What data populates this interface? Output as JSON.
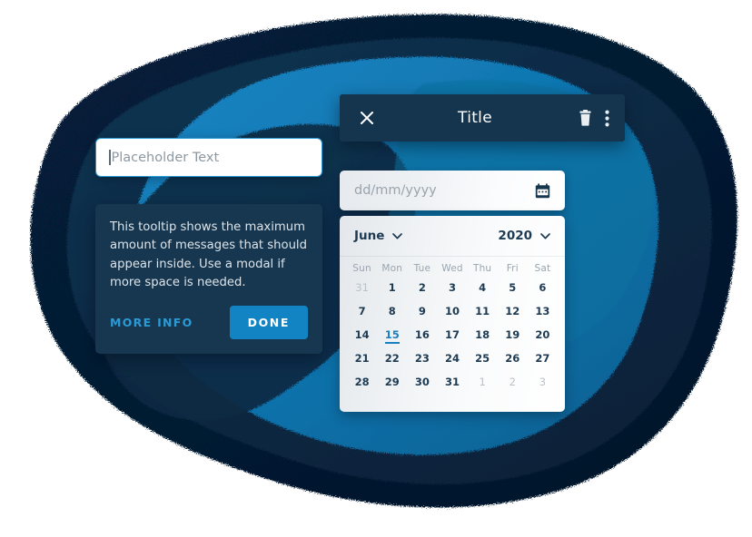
{
  "colors": {
    "blob_outer": "#061d34",
    "blob_mid": "#0b2b45",
    "blob_inner": "#0d72ab",
    "blob_inner2": "#1178b2",
    "accent_blue": "#1283c3",
    "link_blue": "#2b9ad6",
    "dark_navy": "#15354f",
    "tooltip_bg": "#16374f",
    "selected_day": "#1a7fc1",
    "muted_text": "#b9c2ca"
  },
  "modal": {
    "title": "Title",
    "close_icon": "close-x-icon",
    "delete_icon": "trash-icon",
    "overflow_icon": "more-vertical-icon"
  },
  "date_input": {
    "placeholder": "dd/mm/yyyy",
    "value": "",
    "icon": "calendar-icon"
  },
  "calendar": {
    "month": "June",
    "year": "2020",
    "month_chevron": "chevron-down-icon",
    "year_chevron": "chevron-down-icon",
    "weekdays": [
      "Sun",
      "Mon",
      "Tue",
      "Wed",
      "Thu",
      "Fri",
      "Sat"
    ],
    "selected_day": 15,
    "days": [
      {
        "n": "31",
        "muted": true
      },
      {
        "n": "1"
      },
      {
        "n": "2"
      },
      {
        "n": "3"
      },
      {
        "n": "4"
      },
      {
        "n": "5"
      },
      {
        "n": "6"
      },
      {
        "n": "7"
      },
      {
        "n": "8"
      },
      {
        "n": "9"
      },
      {
        "n": "10"
      },
      {
        "n": "11"
      },
      {
        "n": "12"
      },
      {
        "n": "13"
      },
      {
        "n": "14"
      },
      {
        "n": "15",
        "selected": true
      },
      {
        "n": "16"
      },
      {
        "n": "17"
      },
      {
        "n": "18"
      },
      {
        "n": "19"
      },
      {
        "n": "20"
      },
      {
        "n": "21"
      },
      {
        "n": "22"
      },
      {
        "n": "23"
      },
      {
        "n": "24"
      },
      {
        "n": "25"
      },
      {
        "n": "26"
      },
      {
        "n": "27"
      },
      {
        "n": "28"
      },
      {
        "n": "29"
      },
      {
        "n": "30"
      },
      {
        "n": "31"
      },
      {
        "n": "1",
        "muted": true
      },
      {
        "n": "2",
        "muted": true
      },
      {
        "n": "3",
        "muted": true
      }
    ]
  },
  "text_field": {
    "placeholder": "Placeholder Text",
    "value": "",
    "has_caret": true
  },
  "tooltip": {
    "message": "This tooltip shows the maximum amount of messages that should appear inside. Use a modal if more space is needed.",
    "more_info_label": "MORE INFO",
    "done_label": "DONE"
  }
}
